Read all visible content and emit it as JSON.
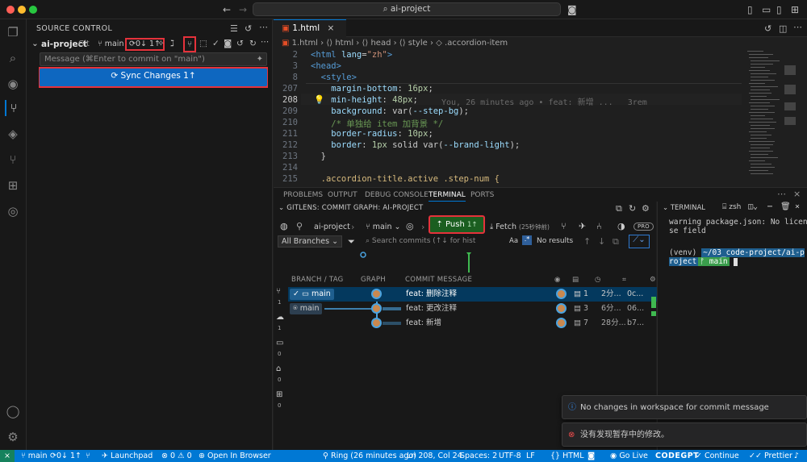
{
  "titlebar": {
    "search": "ai-project"
  },
  "scm": {
    "header": "SOURCE CONTROL",
    "repo_name": "ai-project",
    "repo_type": "Git",
    "branch": "main",
    "sync_counts": "0↓ 1↑",
    "message_placeholder": "Message (⌘Enter to commit on \"main\")",
    "sync_button": "Sync Changes 1↑"
  },
  "editor": {
    "tab": "1.html",
    "breadcrumb": [
      "1.html",
      "html",
      "head",
      "style",
      ".accordion-item"
    ],
    "blame": "You, 26 minutes ago • feat: 新增 ...",
    "blame_suffix": "3rem",
    "lines": [
      {
        "n": "2",
        "code": "<html lang=\"zh\">"
      },
      {
        "n": "3",
        "code": "<head>"
      },
      {
        "n": "8",
        "code": "  <style>"
      },
      {
        "n": "207",
        "code": "    margin-bottom: 16px;"
      },
      {
        "n": "208",
        "code": "    min-height: 48px;"
      },
      {
        "n": "209",
        "code": "    background: var(--step-bg);"
      },
      {
        "n": "210",
        "code": "    /* 单独给 item 加背景 */"
      },
      {
        "n": "211",
        "code": "    border-radius: 10px;"
      },
      {
        "n": "212",
        "code": "    border: 1px solid var(--brand-light);"
      },
      {
        "n": "213",
        "code": "  }"
      },
      {
        "n": "214",
        "code": ""
      },
      {
        "n": "215",
        "code": "  .accordion-title.active .step-num {"
      }
    ]
  },
  "panel": {
    "tabs": [
      "PROBLEMS",
      "OUTPUT",
      "DEBUG CONSOLE",
      "TERMINAL",
      "PORTS"
    ],
    "active_tab": "TERMINAL"
  },
  "gitlens": {
    "title": "GITLENS: COMMIT GRAPH: AI-PROJECT",
    "repo": "ai-project",
    "branch": "main",
    "push_label": "Push",
    "push_count": "1↑",
    "fetch_label": "Fetch",
    "fetch_time": "(25秒钟前)",
    "pro_badge": "PRO",
    "branches_select": "All Branches",
    "search_placeholder": "Search commits (↑↓ for hist",
    "search_aa": "Aa",
    "search_result": "No results",
    "columns": [
      "BRANCH / TAG",
      "GRAPH",
      "COMMIT MESSAGE"
    ],
    "side_counts": [
      "1",
      "1",
      "0",
      "0",
      "0"
    ],
    "rows": [
      {
        "branch": "main",
        "message": "feat: 删除注释",
        "changes": "1",
        "time": "2分...",
        "sha": "0c..."
      },
      {
        "branch": "main",
        "message": "feat: 更改注释",
        "changes": "3",
        "time": "6分...",
        "sha": "06..."
      },
      {
        "branch": "",
        "message": "feat: 新增",
        "changes": "7",
        "time": "28分...",
        "sha": "b7..."
      }
    ]
  },
  "terminal": {
    "title": "TERMINAL",
    "shell": "zsh",
    "warning": "warning package.json: No license field",
    "prompt_env": "(venv)",
    "prompt_path": "~/03_code-project/ai-project",
    "prompt_branch": "main"
  },
  "notifications": [
    {
      "text": "No changes in workspace for commit message",
      "kind": "info"
    },
    {
      "text": "没有发现暂存中的修改。",
      "kind": "error"
    }
  ],
  "statusbar": {
    "branch": "main",
    "sync": "0↓ 1↑",
    "launchpad": "Launchpad",
    "problems": "⊗ 0 ⚠ 0",
    "open_browser": "Open In Browser",
    "blame": "Ring (26 minutes ago)",
    "position": "Ln 208, Col 24",
    "spaces": "Spaces: 2",
    "encoding": "UTF-8",
    "eol": "LF",
    "language": "HTML",
    "golive": "Go Live",
    "codegpt": "CODEGPT",
    "continue": "Continue",
    "prettier": "Prettier"
  },
  "colors": {
    "accent": "#0078d4",
    "sync_button": "#0e67c0",
    "push_button": "#1b5e20",
    "highlight_box": "#e5323b",
    "graph_green": "#3fb950"
  }
}
